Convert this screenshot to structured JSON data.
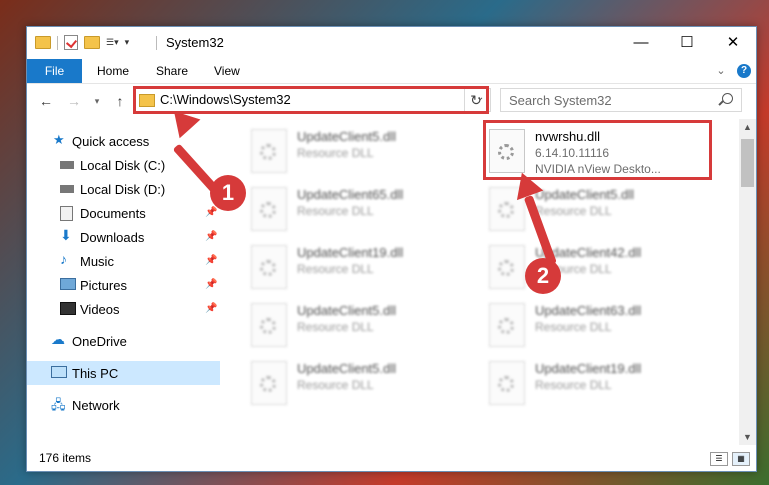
{
  "window": {
    "title": "System32"
  },
  "ribbon": {
    "tabs": [
      "File",
      "Home",
      "Share",
      "View"
    ]
  },
  "address": {
    "path": "C:\\Windows\\System32"
  },
  "search": {
    "placeholder": "Search System32"
  },
  "sidebar": {
    "items": [
      {
        "label": "Quick access"
      },
      {
        "label": "Local Disk (C:)"
      },
      {
        "label": "Local Disk (D:)"
      },
      {
        "label": "Documents"
      },
      {
        "label": "Downloads"
      },
      {
        "label": "Music"
      },
      {
        "label": "Pictures"
      },
      {
        "label": "Videos"
      },
      {
        "label": "OneDrive"
      },
      {
        "label": "This PC"
      },
      {
        "label": "Network"
      }
    ]
  },
  "files": {
    "highlighted": {
      "name": "nvwrshu.dll",
      "version": "6.14.10.11116",
      "desc": "NVIDIA nView Deskto..."
    },
    "col1": [
      {
        "name": "UpdateClient5.dll",
        "type": "Resource DLL"
      },
      {
        "name": "UpdateClient65.dll",
        "type": "Resource DLL"
      },
      {
        "name": "UpdateClient19.dll",
        "type": "Resource DLL"
      },
      {
        "name": "UpdateClient5.dll",
        "type": "Resource DLL"
      },
      {
        "name": "UpdateClient5.dll",
        "type": "Resource DLL"
      }
    ],
    "col2": [
      {
        "name": "UpdateClient5.dll",
        "type": "Resource DLL"
      },
      {
        "name": "UpdateClient42.dll",
        "type": "Resource DLL"
      },
      {
        "name": "UpdateClient63.dll",
        "type": "Resource DLL"
      },
      {
        "name": "UpdateClient19.dll",
        "type": "Resource DLL"
      }
    ]
  },
  "status": {
    "count": "176 items"
  },
  "annotations": {
    "step1": "1",
    "step2": "2",
    "color": "#d63a3a"
  }
}
